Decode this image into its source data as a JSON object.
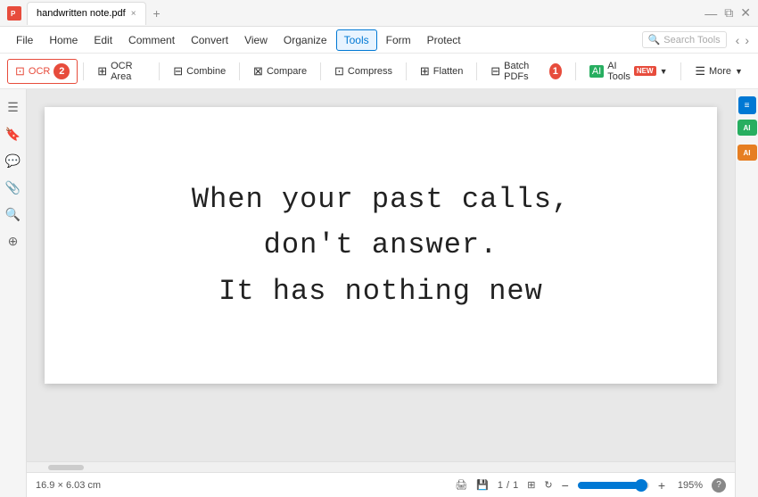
{
  "titlebar": {
    "tab_name": "handwritten note.pdf",
    "close_icon": "×",
    "add_tab_icon": "+"
  },
  "menubar": {
    "items": [
      "Home",
      "Edit",
      "Comment",
      "Convert",
      "View",
      "Organize",
      "Tools",
      "Form",
      "Protect"
    ],
    "active_item": "Tools",
    "search_placeholder": "Search Tools"
  },
  "toolbar": {
    "buttons": [
      {
        "id": "ocr",
        "label": "OCR",
        "highlighted": true
      },
      {
        "id": "ocr-area",
        "label": "OCR Area",
        "highlighted": false
      },
      {
        "id": "combine",
        "label": "Combine",
        "highlighted": false
      },
      {
        "id": "compare",
        "label": "Compare",
        "highlighted": false
      },
      {
        "id": "compress",
        "label": "Compress",
        "highlighted": false
      },
      {
        "id": "flatten",
        "label": "Flatten",
        "highlighted": false
      },
      {
        "id": "batch-pdfs",
        "label": "Batch PDFs",
        "highlighted": false
      },
      {
        "id": "ai-tools",
        "label": "AI Tools",
        "highlighted": false
      },
      {
        "id": "more",
        "label": "More",
        "highlighted": false
      }
    ],
    "badge1_num": "1",
    "badge2_num": "2"
  },
  "sidebar": {
    "icons": [
      "☰",
      "🔖",
      "💬",
      "📎",
      "🔍",
      "⊕"
    ]
  },
  "right_panel": {
    "icons": [
      {
        "id": "panel-icon-1",
        "symbol": "≡",
        "style": "blue"
      },
      {
        "id": "ai-icon",
        "symbol": "AI",
        "style": "green"
      },
      {
        "id": "extra-icon",
        "symbol": "AI",
        "style": "orange"
      }
    ]
  },
  "pdf": {
    "lines": [
      "When your past calls,",
      "don't answer.",
      "It has nothing new"
    ]
  },
  "statusbar": {
    "dimensions": "16.9 × 6.03 cm",
    "page_current": "1",
    "page_total": "1",
    "zoom_percent": "195%"
  }
}
